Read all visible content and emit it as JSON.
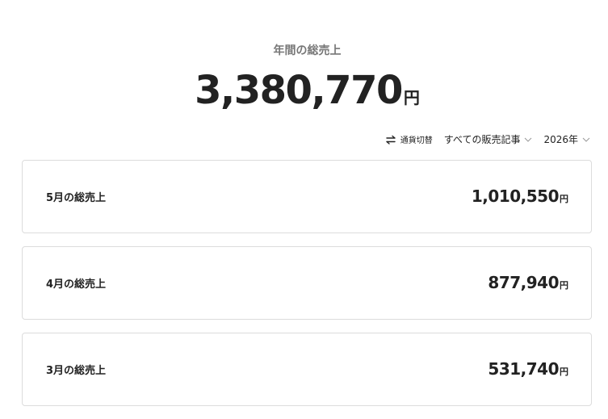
{
  "annual": {
    "label": "年間の総売上",
    "total": "3,380,770",
    "unit": "円"
  },
  "controls": {
    "currency_switch": {
      "icon": "swap-arrows-icon",
      "label": "通貨切替"
    },
    "article_filter": {
      "label": "すべての販売記事",
      "icon": "chevron-down-icon"
    },
    "year_select": {
      "label": "2026年",
      "icon": "chevron-down-icon"
    }
  },
  "months": [
    {
      "label": "5月の総売上",
      "value": "1,010,550",
      "unit": "円"
    },
    {
      "label": "4月の総売上",
      "value": "877,940",
      "unit": "円"
    },
    {
      "label": "3月の総売上",
      "value": "531,740",
      "unit": "円"
    }
  ],
  "colors": {
    "text": "#222222",
    "muted": "#777777",
    "border": "#dcdcdc",
    "background": "#ffffff"
  }
}
